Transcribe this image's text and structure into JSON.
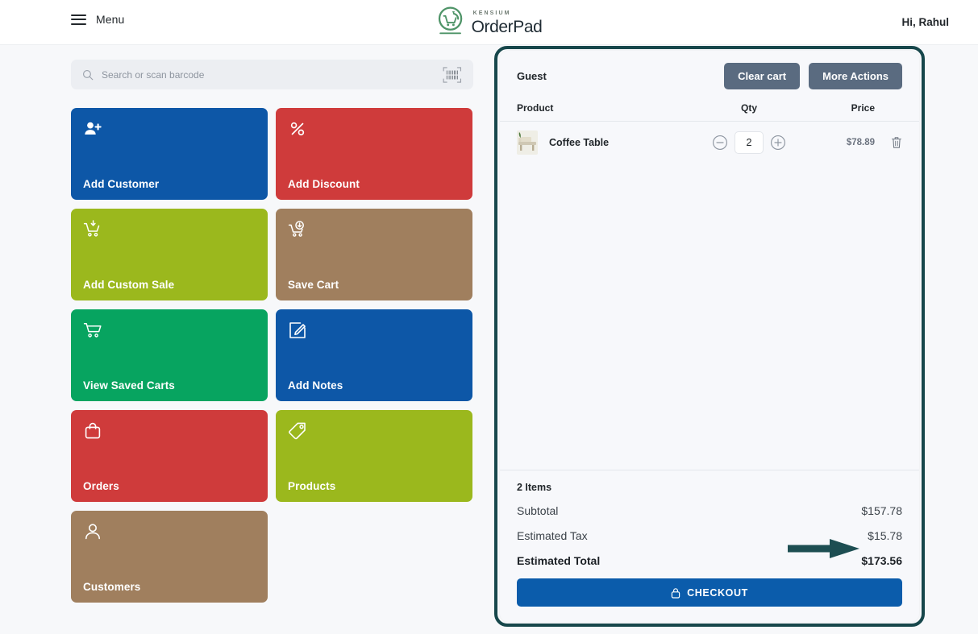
{
  "header": {
    "menu_label": "Menu",
    "menu_icon": "hamburger-icon",
    "brand_eyebrow": "KENSIUM",
    "brand_name": "OrderPad",
    "brand_logo_icon": "orderpad-cart-logo-icon",
    "greeting": "Hi, Rahul"
  },
  "search": {
    "placeholder": "Search or scan barcode",
    "value": "",
    "icon": "search-icon",
    "scan_icon": "barcode-scanner-icon"
  },
  "tiles": [
    {
      "label": "Add Customer",
      "color": "#0d57a7",
      "icon": "user-plus-icon"
    },
    {
      "label": "Add Discount",
      "color": "#cf3b3b",
      "icon": "percent-icon"
    },
    {
      "label": "Add Custom Sale",
      "color": "#9bb81d",
      "icon": "cart-down-icon"
    },
    {
      "label": "Save Cart",
      "color": "#a07f5e",
      "icon": "cart-save-icon"
    },
    {
      "label": "View Saved Carts",
      "color": "#07a460",
      "icon": "cart-icon"
    },
    {
      "label": "Add Notes",
      "color": "#0d57a7",
      "icon": "note-edit-icon"
    },
    {
      "label": "Orders",
      "color": "#cf3b3b",
      "icon": "bag-icon"
    },
    {
      "label": "Products",
      "color": "#9bb81d",
      "icon": "tag-icon"
    },
    {
      "label": "Customers",
      "color": "#a07f5e",
      "icon": "person-icon"
    }
  ],
  "cart": {
    "customer": "Guest",
    "clear_cart_label": "Clear cart",
    "more_actions_label": "More Actions",
    "columns": {
      "product": "Product",
      "qty": "Qty",
      "price": "Price"
    },
    "items": [
      {
        "name": "Coffee Table",
        "qty": "2",
        "price": "$78.89",
        "thumb_icon": "product-thumbnail",
        "decrement_icon": "minus-circle-icon",
        "increment_icon": "plus-circle-icon",
        "delete_icon": "trash-icon"
      }
    ],
    "items_count_label": "2 Items",
    "totals": [
      {
        "label": "Subtotal",
        "value": "$157.78"
      },
      {
        "label": "Estimated Tax",
        "value": "$15.78"
      },
      {
        "label": "Estimated Total",
        "value": "$173.56"
      }
    ],
    "checkout_label": "CHECKOUT",
    "checkout_icon": "lock-icon"
  },
  "annotations": {
    "panel_highlight_color": "#17474b",
    "arrow_color": "#1d4e52",
    "arrow_target": "Estimated Tax"
  }
}
